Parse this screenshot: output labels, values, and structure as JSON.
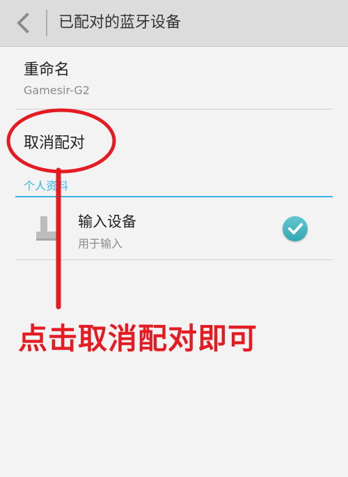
{
  "header": {
    "title": "已配对的蓝牙设备",
    "back_icon": "chevron-left-icon"
  },
  "rename": {
    "title": "重命名",
    "device_name": "Gamesir-G2"
  },
  "unpair": {
    "label": "取消配对"
  },
  "profiles": {
    "section_label": "个人资料",
    "input_device": {
      "title": "输入设备",
      "subtitle": "用于输入",
      "icon": "joystick-icon",
      "checked_icon": "checkmark-icon",
      "checked": true
    }
  },
  "annotation": {
    "callout": "点击取消配对即可",
    "color": "#e51b24"
  },
  "colors": {
    "accent": "#33b5e5",
    "check": "#3aaebb"
  }
}
